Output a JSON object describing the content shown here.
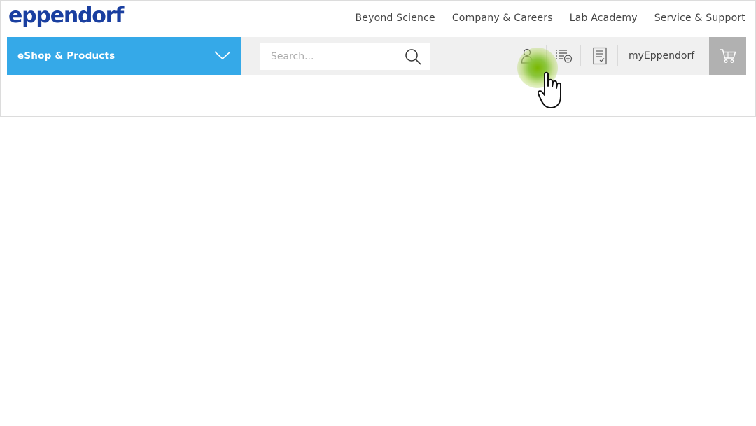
{
  "brand": {
    "logo_text": "eppendorf"
  },
  "topnav": [
    {
      "label": "Beyond Science"
    },
    {
      "label": "Company & Careers"
    },
    {
      "label": "Lab Academy"
    },
    {
      "label": "Service & Support"
    }
  ],
  "toolbar": {
    "eshop_label": "eShop & Products",
    "search_placeholder": "Search...",
    "my_label": "myEppendorf"
  },
  "icons": {
    "eshop_menu": "chevron-down-icon",
    "search": "search-icon",
    "account": "user-icon",
    "lists": "list-add-icon",
    "quotes": "document-check-icon",
    "cart": "cart-icon",
    "cursor": "hand-pointer-icon"
  },
  "colors": {
    "brand_blue": "#1a3fa0",
    "eshop_bg": "#35a9e8",
    "toolbar_bg": "#f0f0f0",
    "cart_bg": "#b1b1b1",
    "click_highlight": "#8cc63f"
  }
}
